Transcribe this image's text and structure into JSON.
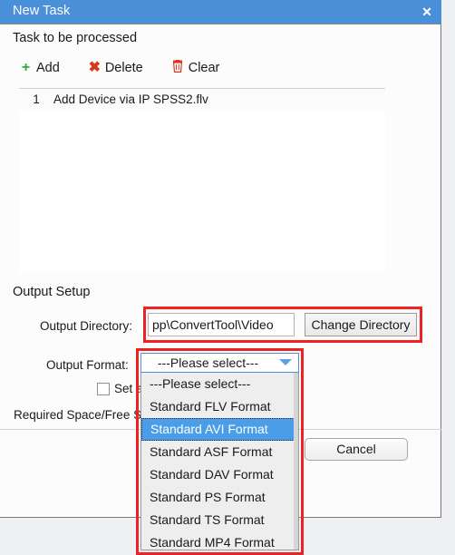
{
  "window": {
    "title": "New Task",
    "close_label": "✕",
    "close_icon": "close-icon"
  },
  "task_section": {
    "heading": "Task to be processed",
    "toolbar": [
      {
        "label": "Add",
        "icon": "plus-icon",
        "glyph": "+"
      },
      {
        "label": "Delete",
        "icon": "cross-icon",
        "glyph": "✖"
      },
      {
        "label": "Clear",
        "icon": "trash-icon",
        "glyph": "Ὕ1"
      }
    ],
    "rows": [
      {
        "index": "1",
        "name": "Add Device via IP SPSS2.flv"
      }
    ]
  },
  "output_section": {
    "heading": "Output Setup",
    "directory_label": "Output Directory:",
    "directory_value": "pp\\ConvertTool\\Video",
    "directory_placeholder": "",
    "change_directory_label": "Change Directory",
    "format_label": "Output Format:",
    "format_selected": "---Please select---",
    "format_options": [
      "---Please select---",
      "Standard FLV Format",
      "Standard AVI Format",
      "Standard ASF Format",
      "Standard DAV Format",
      "Standard PS Format",
      "Standard TS Format",
      "Standard MP4 Format"
    ],
    "format_highlighted": "Standard AVI Format",
    "checkbox_label": "Set a",
    "checkbox_checked": false,
    "required_space_label": "Required Space/Free Sp"
  },
  "buttons": {
    "cancel_label": "Cancel"
  },
  "colors": {
    "titlebar": "#4a90d9",
    "accent": "#4a9ee8",
    "annotation": "#ee2222",
    "add_icon": "#2eab45",
    "delete_icon": "#d9381e"
  }
}
